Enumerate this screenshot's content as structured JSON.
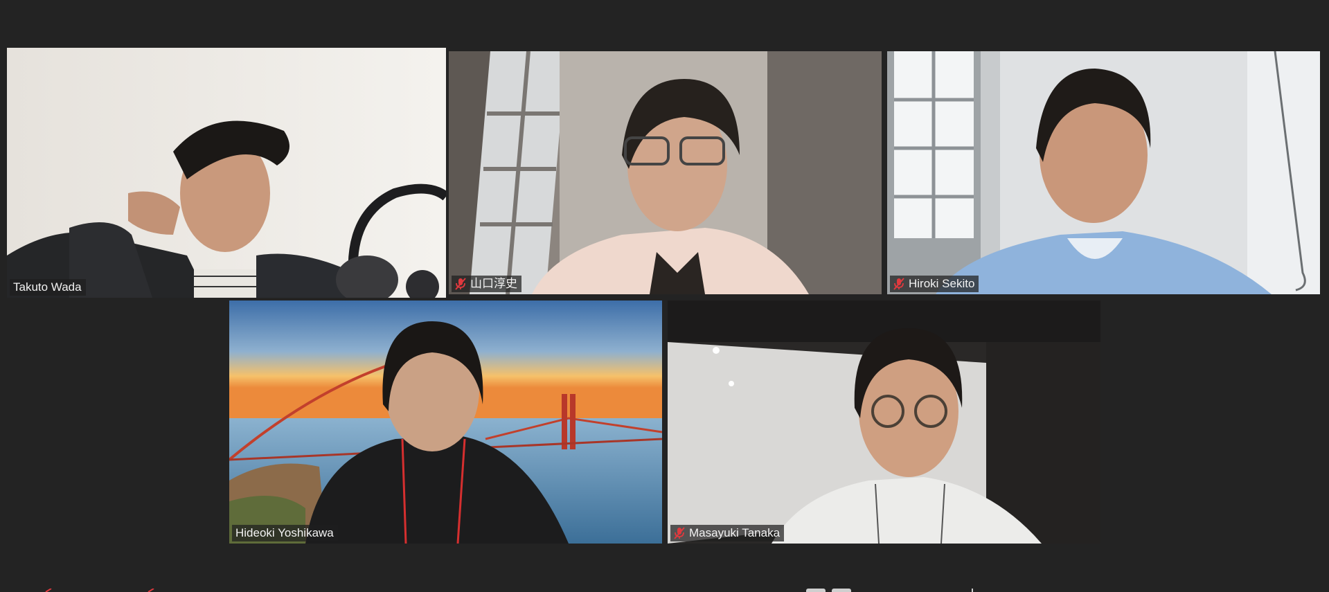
{
  "meeting": {
    "participants": [
      {
        "id": "p1",
        "name": "Takuto Wada",
        "muted": false,
        "active_speaker": true
      },
      {
        "id": "p2",
        "name": "山口淳史",
        "muted": true,
        "active_speaker": false
      },
      {
        "id": "p3",
        "name": "Hiroki Sekito",
        "muted": true,
        "active_speaker": false
      },
      {
        "id": "p4",
        "name": "Hideoki Yoshikawa",
        "muted": false,
        "active_speaker": false
      },
      {
        "id": "p5",
        "name": "Masayuki Tanaka",
        "muted": true,
        "active_speaker": false
      }
    ]
  },
  "colors": {
    "background": "#232323",
    "active_speaker_border": "#b8e04a",
    "mute_icon": "#e0393e",
    "name_tag_bg": "#1e1e1e"
  },
  "icons": {
    "mute": "microphone-muted-icon"
  }
}
